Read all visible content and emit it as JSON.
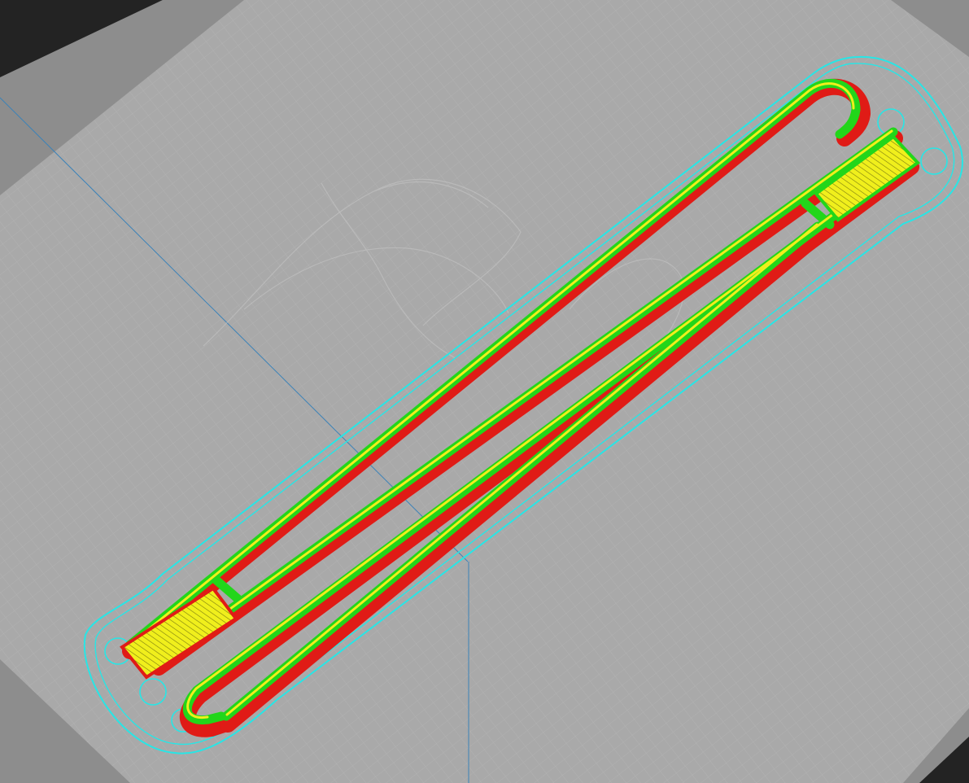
{
  "viewport": {
    "kind": "3d-print-slicer-layer-preview",
    "background_color": "#232323",
    "build_plate_color": "#a9a9a9",
    "plate_border_color": "#8a8a8a"
  },
  "legend_colors": {
    "skirt_brim": "#27e6e6",
    "outer_wall": "#e01b16",
    "inner_wall": "#22d61a",
    "infill": "#f0ef1c"
  },
  "model": {
    "shape": "folded-loop-strip",
    "support_icon": "ghost-watermark-icon"
  }
}
